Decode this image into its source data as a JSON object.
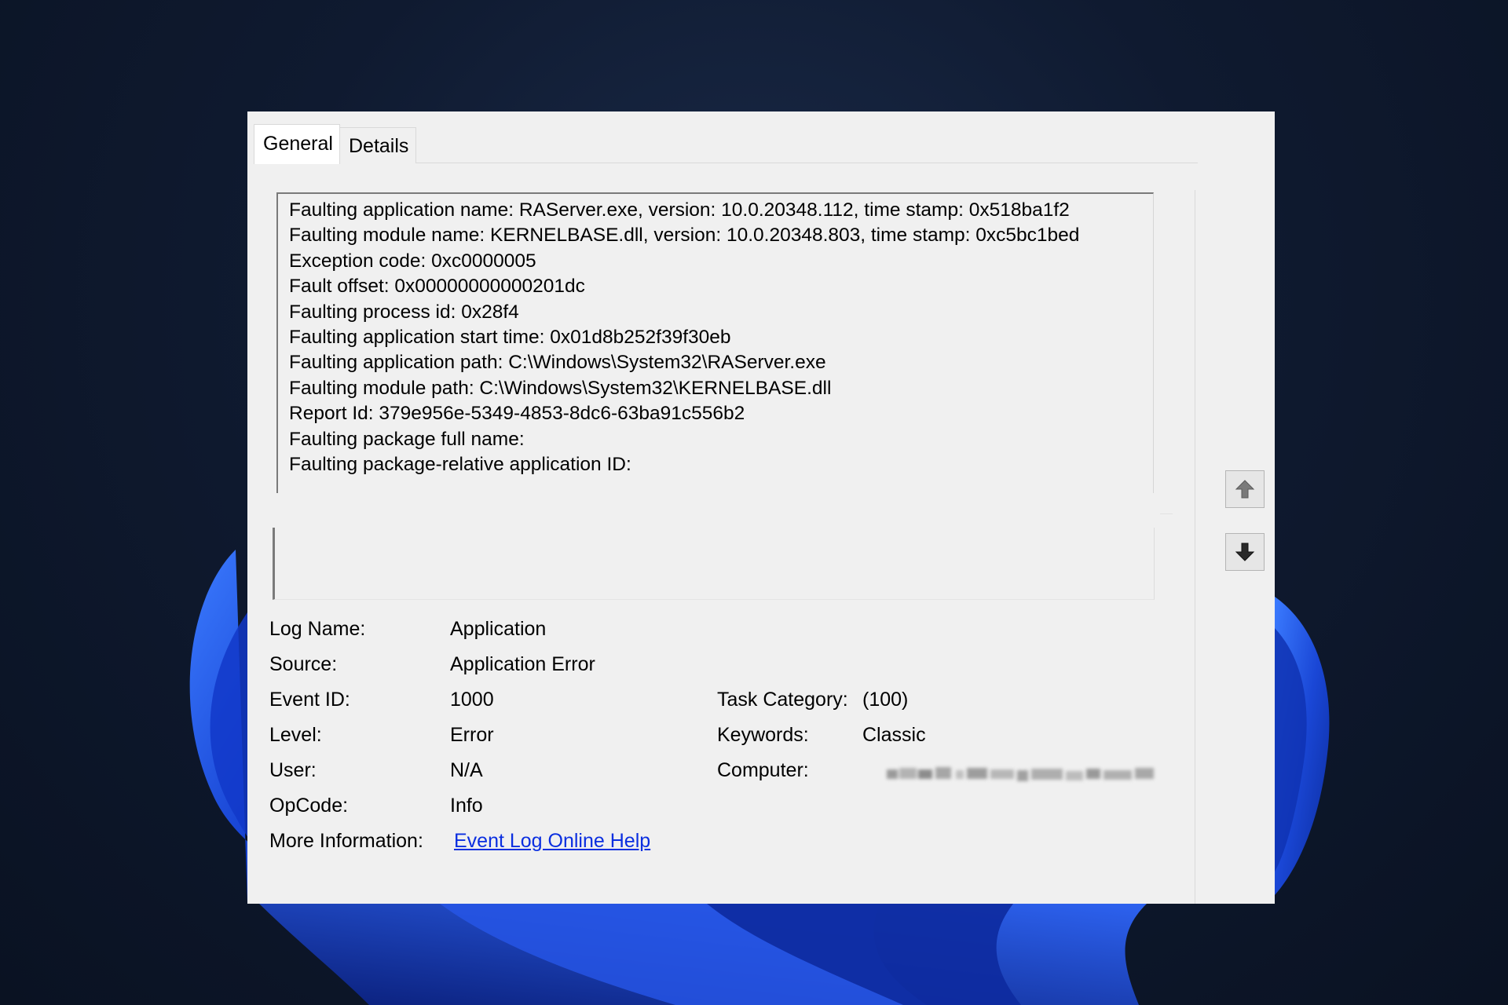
{
  "tabs": [
    {
      "label": "General",
      "active": true
    },
    {
      "label": "Details",
      "active": false
    }
  ],
  "description_lines": [
    "Faulting application name: RAServer.exe, version: 10.0.20348.112, time stamp: 0x518ba1f2",
    "Faulting module name: KERNELBASE.dll, version: 10.0.20348.803, time stamp: 0xc5bc1bed",
    "Exception code: 0xc0000005",
    "Fault offset: 0x00000000000201dc",
    "Faulting process id: 0x28f4",
    "Faulting application start time: 0x01d8b252f39f30eb",
    "Faulting application path: C:\\Windows\\System32\\RAServer.exe",
    "Faulting module path: C:\\Windows\\System32\\KERNELBASE.dll",
    "Report Id: 379e956e-5349-4853-8dc6-63ba91c556b2",
    "Faulting package full name:",
    "Faulting package-relative application ID:"
  ],
  "properties": {
    "log_name": {
      "label": "Log Name:",
      "value": "Application"
    },
    "source": {
      "label": "Source:",
      "value": "Application Error"
    },
    "event_id": {
      "label": "Event ID:",
      "value": "1000"
    },
    "task_category": {
      "label": "Task Category:",
      "value": "(100)"
    },
    "level": {
      "label": "Level:",
      "value": "Error"
    },
    "keywords": {
      "label": "Keywords:",
      "value": "Classic"
    },
    "user": {
      "label": "User:",
      "value": "N/A"
    },
    "computer": {
      "label": "Computer:",
      "value": ""
    },
    "opcode": {
      "label": "OpCode:",
      "value": "Info"
    },
    "more_information": {
      "label": "More Information:",
      "link": "Event Log Online Help"
    }
  },
  "navigation": {
    "up_icon": "arrow-up-icon",
    "down_icon": "arrow-down-icon"
  },
  "colors": {
    "link": "#0a2ee0",
    "dialog_background": "#f0f0f0",
    "desktop_background": "#0f1a30",
    "wallpaper_accent": "#1e4bd8"
  }
}
